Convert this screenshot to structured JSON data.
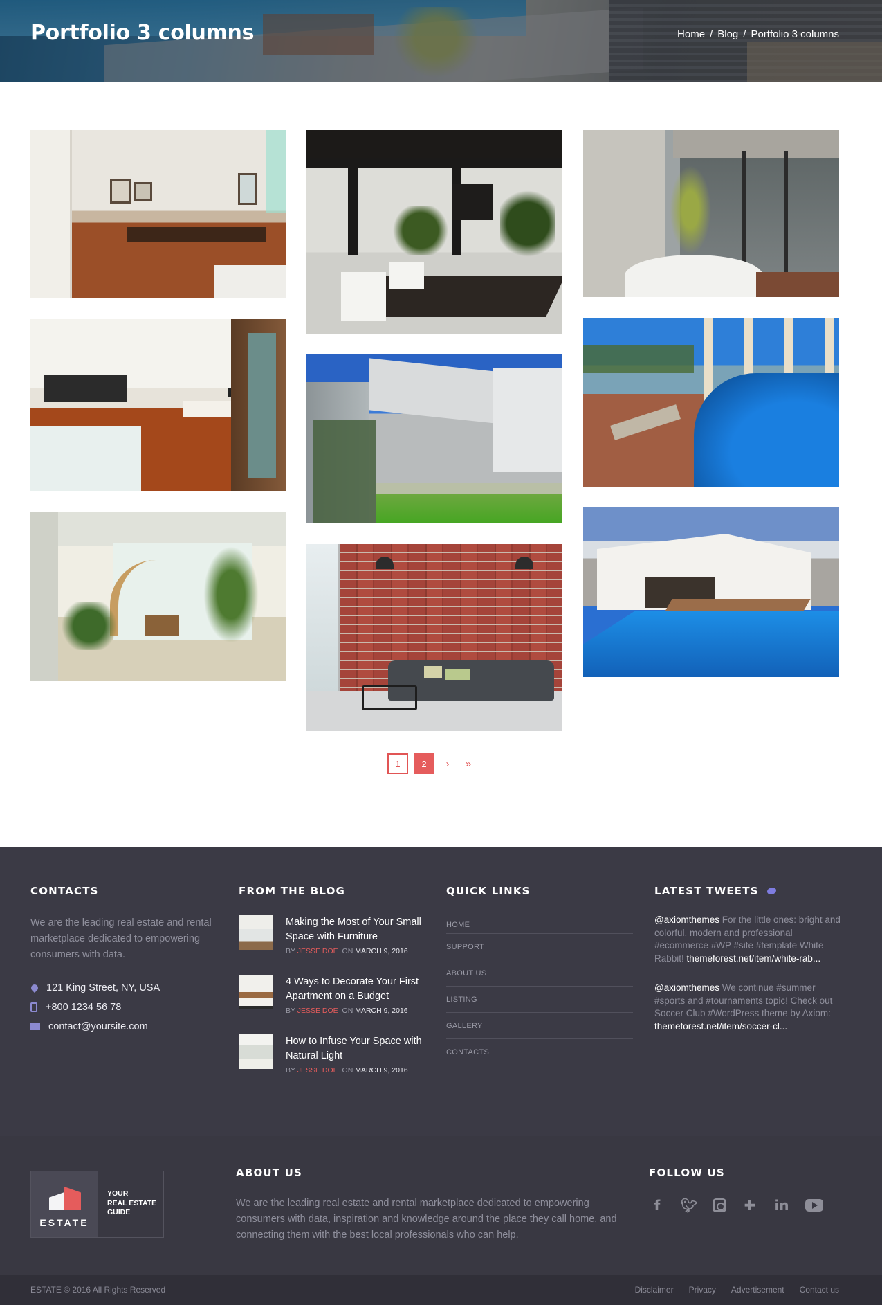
{
  "header": {
    "title": "Portfolio 3 columns",
    "breadcrumb": [
      "Home",
      "Blog",
      "Portfolio 3 columns"
    ],
    "breadcrumb_separator": "/"
  },
  "portfolio": {
    "columns": 3,
    "items": [
      {
        "scene": "dining room"
      },
      {
        "scene": "dark modern hall"
      },
      {
        "scene": "glass courtyard"
      },
      {
        "scene": "open kitchen"
      },
      {
        "scene": "concrete frame"
      },
      {
        "scene": "pool deck"
      },
      {
        "scene": "spiral staircase"
      },
      {
        "scene": "brick wall sofa"
      },
      {
        "scene": "villa with pool"
      }
    ]
  },
  "pagination": {
    "pages": [
      "1",
      "2"
    ],
    "current": "2",
    "next": "›",
    "last": "»"
  },
  "footer": {
    "contacts": {
      "heading": "CONTACTS",
      "text": "We are the leading real estate and rental marketplace dedicated to empowering consumers with data.",
      "address": "121 King Street, NY, USA",
      "phone": "+800 1234 56 78",
      "email": "contact@yoursite.com"
    },
    "blog": {
      "heading": "FROM THE BLOG",
      "by": "BY",
      "on": "ON",
      "posts": [
        {
          "title": "Making the Most of Your Small Space with Furniture",
          "author": "JESSE DOE",
          "date": "MARCH 9, 2016"
        },
        {
          "title": "4 Ways to Decorate Your First Apartment on a Budget",
          "author": "JESSE DOE",
          "date": "MARCH 9, 2016"
        },
        {
          "title": "How to Infuse Your Space with Natural Light",
          "author": "JESSE DOE",
          "date": "MARCH 9, 2016"
        }
      ]
    },
    "quick_links": {
      "heading": "QUICK LINKS",
      "items": [
        "HOME",
        "SUPPORT",
        "ABOUT US",
        "LISTING",
        "GALLERY",
        "CONTACTS"
      ]
    },
    "tweets": {
      "heading": "LATEST TWEETS",
      "items": [
        {
          "handle": "@axiomthemes",
          "text": " For the little ones: bright and colorful, modern and professional #ecommerce #WP #site #template White Rabbit! ",
          "link": "themeforest.net/item/white-rab..."
        },
        {
          "handle": "@axiomthemes",
          "text": " We continue #summer #sports and #tournaments topic! Check out Soccer Club #WordPress theme by Axiom: ",
          "link": "themeforest.net/item/soccer-cl..."
        }
      ]
    },
    "brand": {
      "word": "ESTATE",
      "tagline": [
        "YOUR",
        "REAL ESTATE",
        "GUIDE"
      ]
    },
    "about": {
      "heading": "ABOUT US",
      "text": "We are the leading real estate and rental marketplace dedicated to empowering consumers with data, inspiration and knowledge around the place they call home, and connecting them with the best local professionals who can help."
    },
    "follow": {
      "heading": "FOLLOW US",
      "networks": [
        "facebook-icon",
        "twitter-icon",
        "instagram-icon",
        "plus-icon",
        "linkedin-icon",
        "youtube-icon"
      ]
    },
    "copyright": "ESTATE © 2016 All Rights Reserved",
    "bottom_links": [
      "Disclaimer",
      "Privacy",
      "Advertisement",
      "Contact us"
    ]
  },
  "colors": {
    "accent": "#e55c5c",
    "footer_bg": "#3b3a45",
    "icon_accent": "#8c8ad0"
  }
}
